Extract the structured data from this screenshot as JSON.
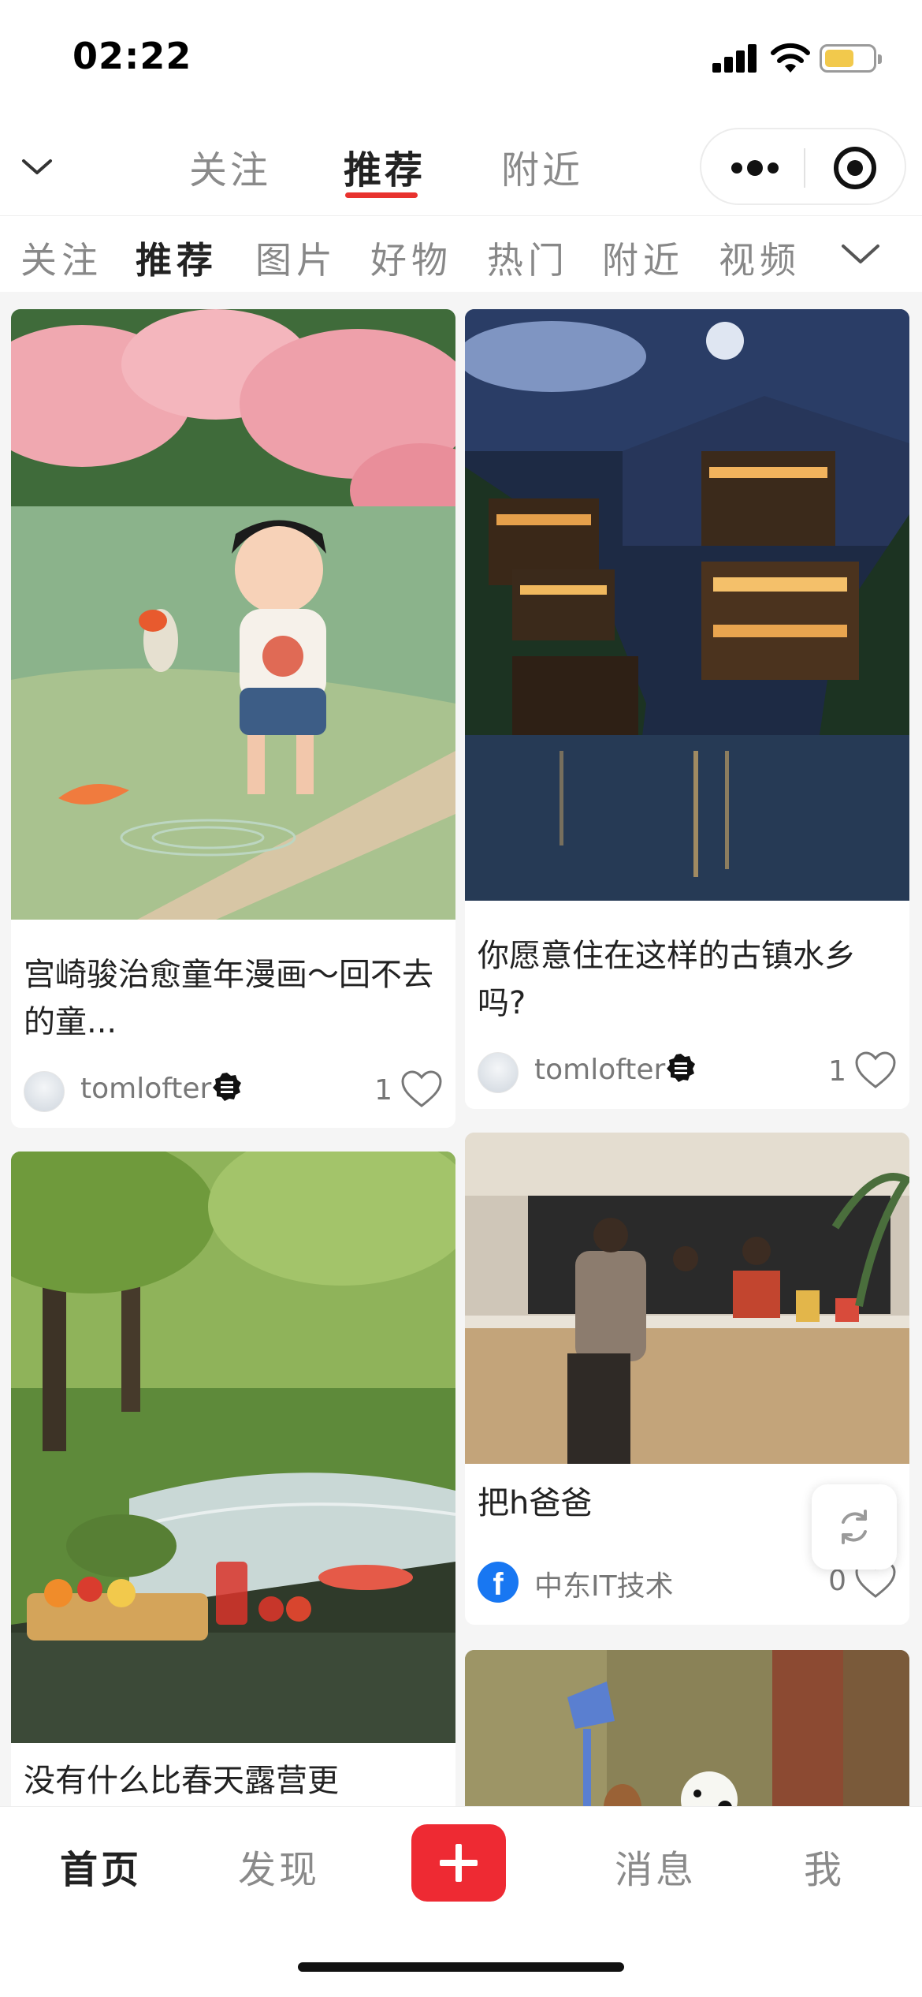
{
  "status_bar": {
    "time": "02:22"
  },
  "top_nav": {
    "tabs": [
      {
        "label": "关注"
      },
      {
        "label": "推荐"
      },
      {
        "label": "附近"
      }
    ],
    "active_tab": "推荐"
  },
  "categories": [
    {
      "label": "关注"
    },
    {
      "label": "推荐"
    },
    {
      "label": "图片"
    },
    {
      "label": "好物"
    },
    {
      "label": "热门"
    },
    {
      "label": "附近"
    },
    {
      "label": "视频"
    }
  ],
  "active_category": "推荐",
  "feed": [
    {
      "title": "宫崎骏治愈童年漫画～回不去的童...",
      "author": "tomlofter",
      "likes": "1"
    },
    {
      "title": "你愿意住在这样的古镇水乡吗?",
      "author": "tomlofter",
      "likes": "1"
    },
    {
      "title": "没有什么比春天露营更",
      "author": "",
      "likes": ""
    },
    {
      "title": "把h爸爸",
      "author": "中东IT技术",
      "likes": "0"
    }
  ],
  "bottom_nav": {
    "items": [
      {
        "label": "首页"
      },
      {
        "label": "发现"
      },
      {
        "label": "消息"
      },
      {
        "label": "我"
      }
    ]
  },
  "colors": {
    "accent": "#ee2a33",
    "battery": "#f2c94c",
    "facebook": "#1877f2"
  },
  "battery_level": 0.55
}
